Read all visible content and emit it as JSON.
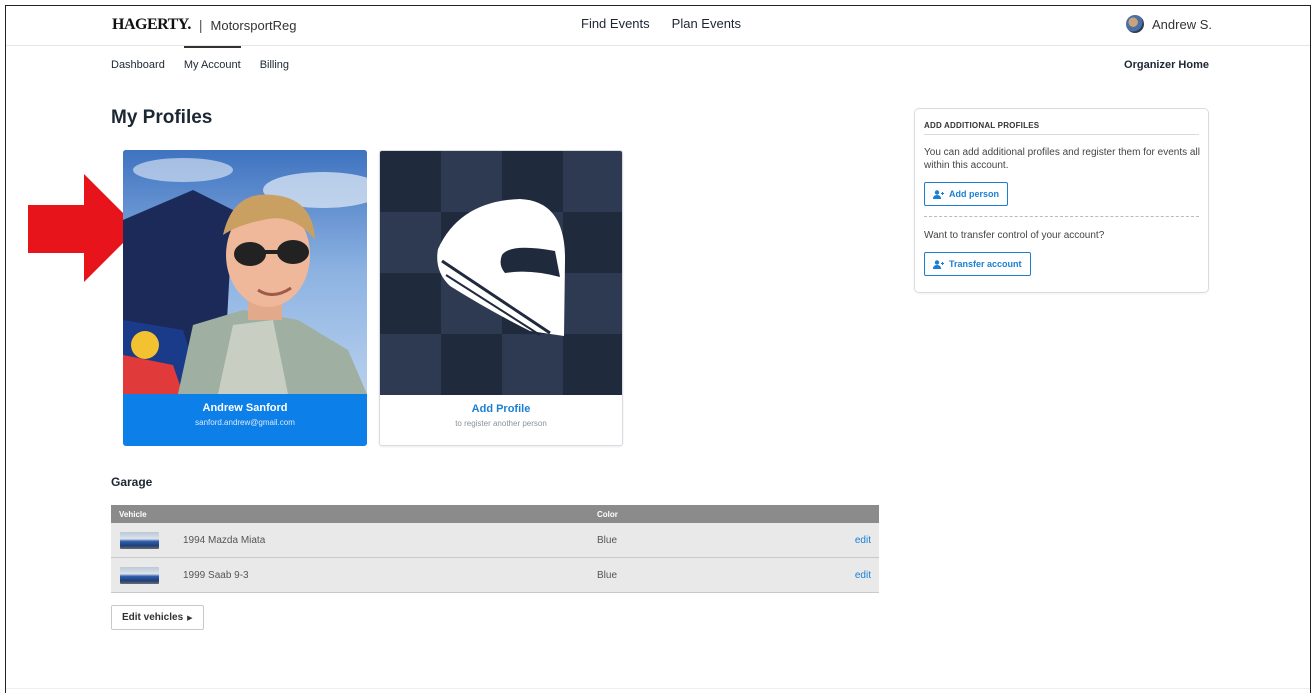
{
  "header": {
    "logo": "HAGERTY.",
    "separator": "|",
    "product": "MotorsportReg",
    "nav": [
      "Find Events",
      "Plan Events"
    ],
    "user_name": "Andrew S."
  },
  "subnav": {
    "items": [
      "Dashboard",
      "My Account",
      "Billing"
    ],
    "active": "My Account",
    "right_link": "Organizer Home"
  },
  "page": {
    "title": "My Profiles"
  },
  "profiles": [
    {
      "name": "Andrew Sanford",
      "email": "sanford.andrew@gmail.com"
    }
  ],
  "add_profile": {
    "label": "Add Profile",
    "sub": "to register another person"
  },
  "side_panel": {
    "title": "ADD ADDITIONAL PROFILES",
    "description": "You can add additional profiles and register them for events all within this account.",
    "add_person_label": "Add person",
    "transfer_prompt": "Want to transfer control of your account?",
    "transfer_label": "Transfer account"
  },
  "garage": {
    "title": "Garage",
    "columns": [
      "Vehicle",
      "Color"
    ],
    "rows": [
      {
        "vehicle": "1994 Mazda Miata",
        "color": "Blue",
        "action": "edit"
      },
      {
        "vehicle": "1999 Saab 9-3",
        "color": "Blue",
        "action": "edit"
      }
    ],
    "edit_vehicles_label": "Edit vehicles"
  },
  "colors": {
    "accent": "#1a7fd4",
    "profile_card": "#0d7fe9",
    "arrow": "#e8141c",
    "table_header": "#8b8b8b"
  }
}
